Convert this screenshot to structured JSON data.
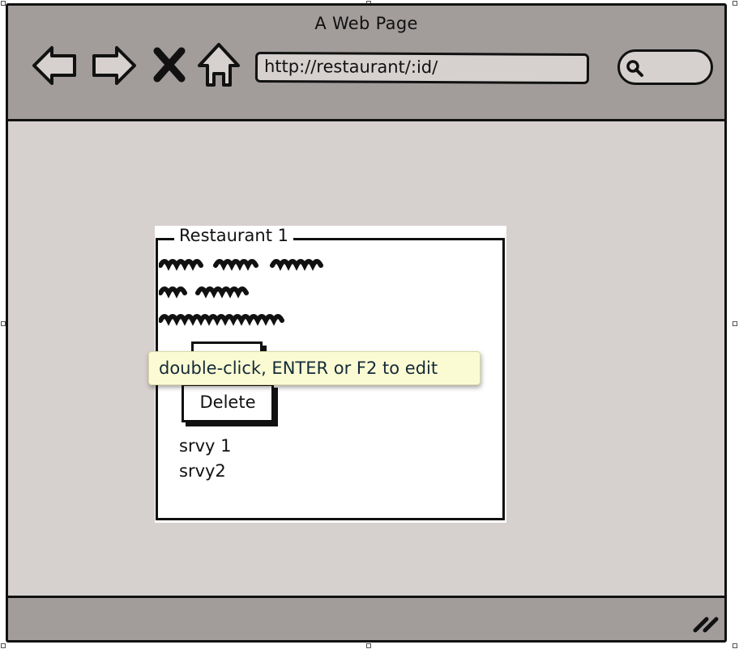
{
  "window": {
    "title": "A Web Page",
    "url": "http://restaurant/:id/"
  },
  "toolbar": {
    "icons": [
      "back-arrow-icon",
      "forward-arrow-icon",
      "close-x-icon",
      "home-icon",
      "search-icon"
    ]
  },
  "panel": {
    "legend": "Restaurant 1",
    "edit_label": "Edit",
    "delete_label": "Delete",
    "surveys": [
      "srvy 1",
      "srvy2"
    ]
  },
  "tooltip": {
    "text": "double-click, ENTER or F2 to edit"
  },
  "colors": {
    "chrome": "#a29c9b",
    "canvas": "#d6d0cf",
    "panel": "#ffffff",
    "tooltip": "#fbfbd3",
    "ink": "#111111"
  }
}
